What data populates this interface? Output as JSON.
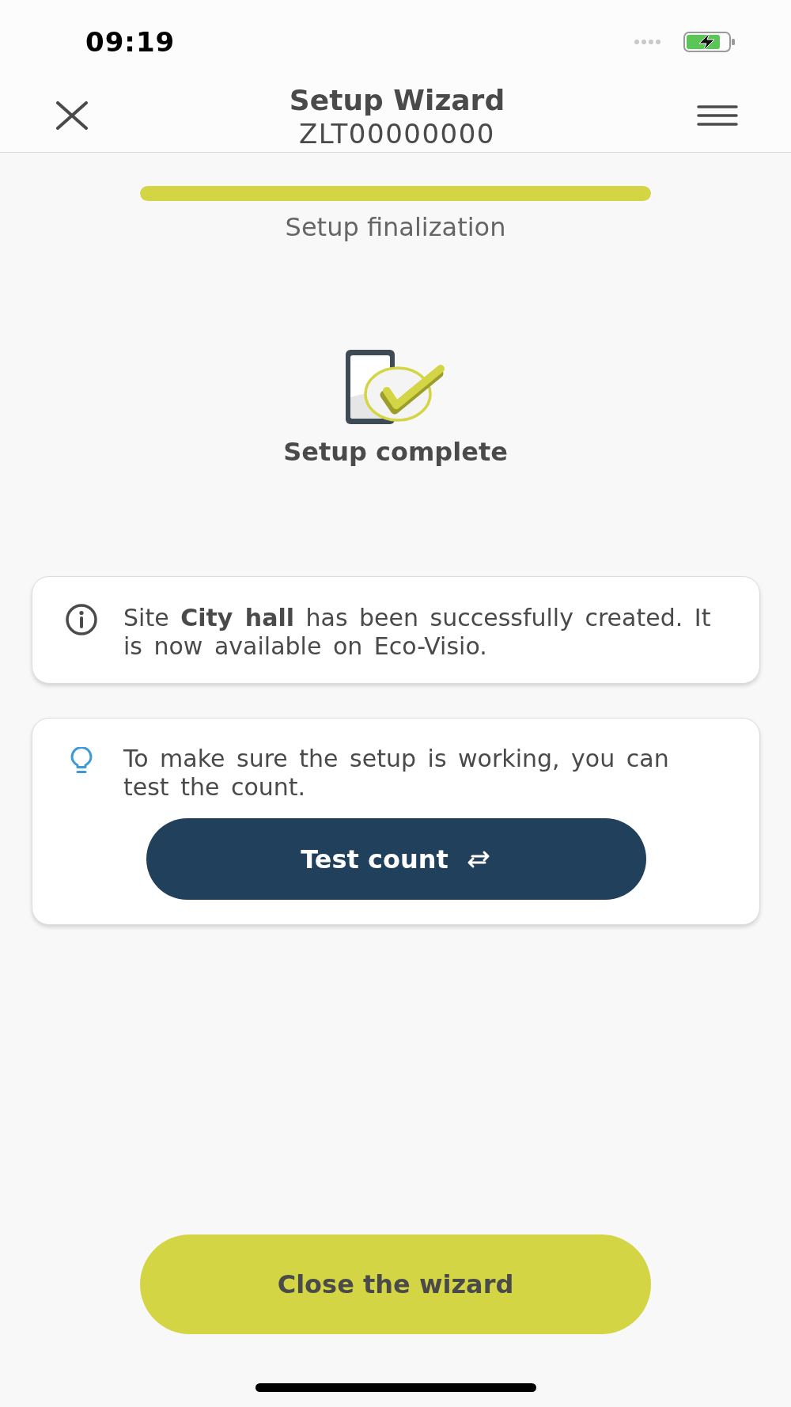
{
  "status_bar": {
    "time": "09:19"
  },
  "header": {
    "title": "Setup Wizard",
    "subtitle": "ZLT00000000"
  },
  "progress": {
    "level": 1,
    "label": "Setup finalization"
  },
  "result": {
    "title": "Setup complete"
  },
  "cards": [
    {
      "kind": "info",
      "text": "Site **City hall** has been successfully created. It is now available on Eco-Visio."
    },
    {
      "kind": "tip",
      "text": "To make sure the setup is working, you can test the count.",
      "button": "Test count"
    }
  ],
  "footer_button": "Close the wizard"
}
